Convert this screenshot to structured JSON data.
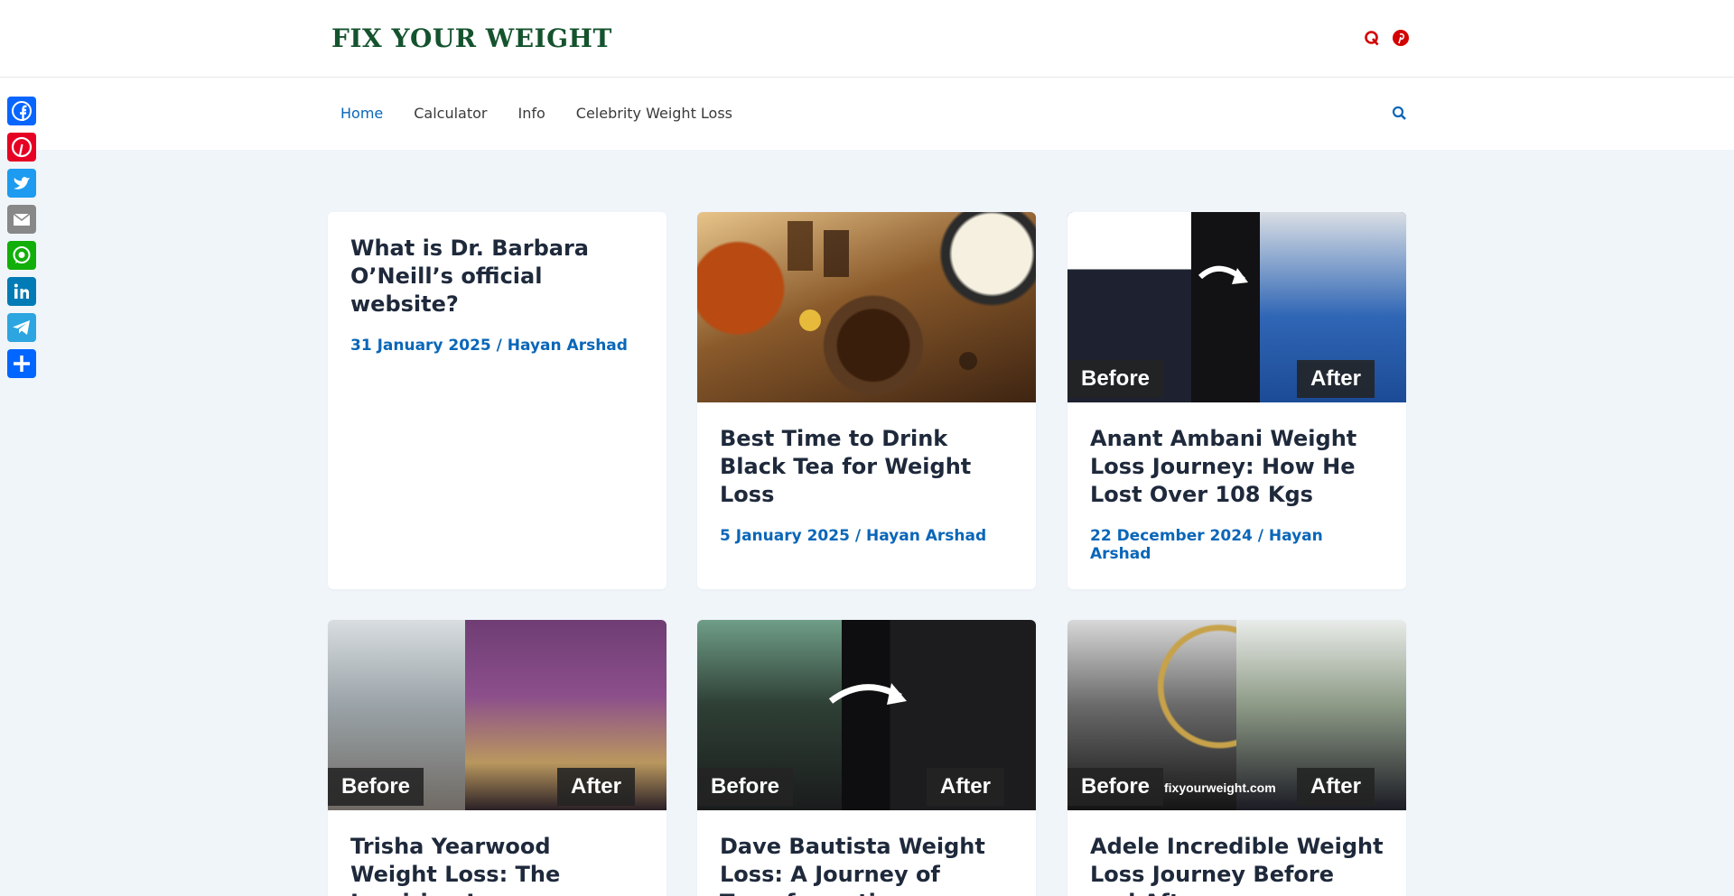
{
  "header": {
    "logo": "FIX YOUR WEIGHT",
    "icons": [
      "quora-icon",
      "pinterest-icon"
    ]
  },
  "nav": {
    "items": [
      {
        "label": "Home",
        "active": true
      },
      {
        "label": "Calculator",
        "active": false
      },
      {
        "label": "Info",
        "active": false
      },
      {
        "label": "Celebrity Weight Loss",
        "active": false
      }
    ],
    "search_icon": "search-icon"
  },
  "share_bar": [
    "facebook-icon",
    "pinterest-icon",
    "twitter-icon",
    "email-icon",
    "whatsapp-icon",
    "linkedin-icon",
    "telegram-icon",
    "share-add-icon"
  ],
  "posts": [
    {
      "title": "What is Dr. Barbara O’Neill’s official website?",
      "date": "31 January 2025",
      "author": "Hayan Arshad"
    },
    {
      "title": "Best Time to Drink Black Tea for Weight Loss",
      "date": "5 January 2025",
      "author": "Hayan Arshad"
    },
    {
      "title": "Anant Ambani Weight Loss Journey: How He Lost Over 108 Kgs",
      "date": "22 December 2024",
      "author": "Hayan Arshad",
      "before": "Before",
      "after": "After"
    },
    {
      "title": "Trisha Yearwood Weight Loss: The Inspiring Journey",
      "before": "Before",
      "after": "After"
    },
    {
      "title": "Dave Bautista Weight Loss: A Journey of Transformation",
      "before": "Before",
      "after": "After"
    },
    {
      "title": "Adele Incredible Weight Loss Journey Before and After",
      "before": "Before",
      "after": "After",
      "watermark": "fixyourweight.com"
    }
  ],
  "meta_separator": " / ",
  "colors": {
    "accent": "#0a66b8",
    "logo": "#14532d",
    "background": "#f0f5fa"
  }
}
